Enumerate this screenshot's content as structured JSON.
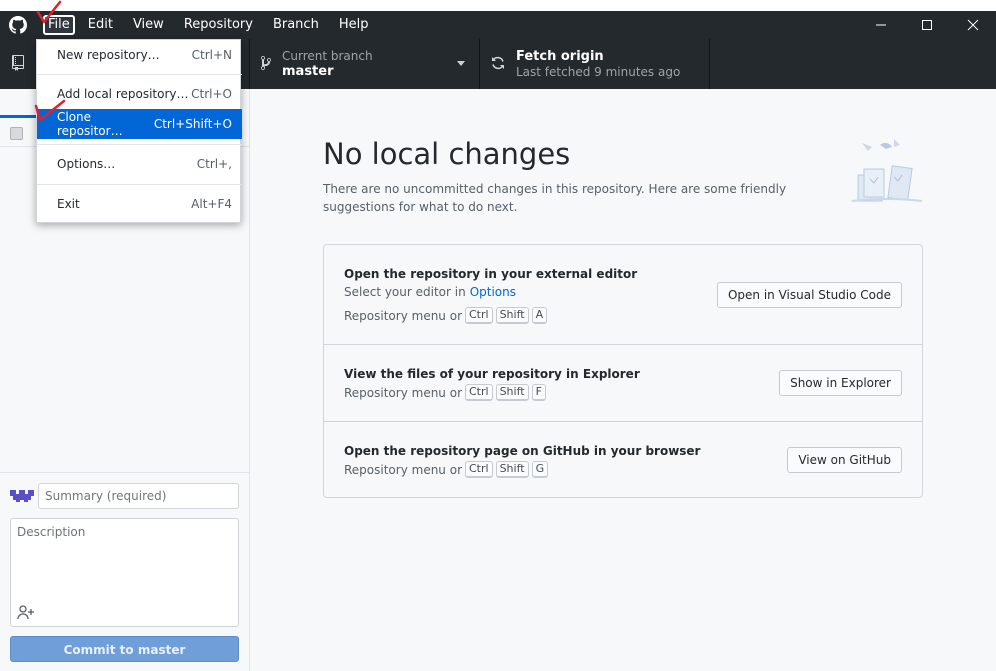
{
  "titlebar": {
    "menus": [
      "File",
      "Edit",
      "View",
      "Repository",
      "Branch",
      "Help"
    ]
  },
  "toolbar": {
    "branch_label": "Current branch",
    "branch_value": "master",
    "fetch_label": "Fetch origin",
    "fetch_sub": "Last fetched 9 minutes ago"
  },
  "file_menu": {
    "items": [
      {
        "label": "New repository…",
        "shortcut": "Ctrl+N"
      },
      {
        "label": "Add local repository…",
        "shortcut": "Ctrl+O"
      },
      {
        "label": "Clone repositor…",
        "shortcut": "Ctrl+Shift+O"
      },
      {
        "label": "Options…",
        "shortcut": "Ctrl+,"
      },
      {
        "label": "Exit",
        "shortcut": "Alt+F4"
      }
    ]
  },
  "sidebar": {
    "summary_placeholder": "Summary (required)",
    "description_placeholder": "Description",
    "commit_prefix": "Commit to ",
    "commit_branch": "master"
  },
  "main": {
    "title": "No local changes",
    "description": "There are no uncommitted changes in this repository. Here are some friendly suggestions for what to do next.",
    "cards": [
      {
        "title": "Open the repository in your external editor",
        "line1_prefix": "Select your editor in",
        "line1_link": "Options",
        "shortcut_prefix": "Repository menu or",
        "keys": [
          "Ctrl",
          "Shift",
          "A"
        ],
        "button": "Open in Visual Studio Code"
      },
      {
        "title": "View the files of your repository in Explorer",
        "shortcut_prefix": "Repository menu or",
        "keys": [
          "Ctrl",
          "Shift",
          "F"
        ],
        "button": "Show in Explorer"
      },
      {
        "title": "Open the repository page on GitHub in your browser",
        "shortcut_prefix": "Repository menu or",
        "keys": [
          "Ctrl",
          "Shift",
          "G"
        ],
        "button": "View on GitHub"
      }
    ]
  },
  "colors": {
    "titlebar_bg": "#24292e",
    "accent": "#0366d6",
    "annotation": "#e0212a"
  }
}
